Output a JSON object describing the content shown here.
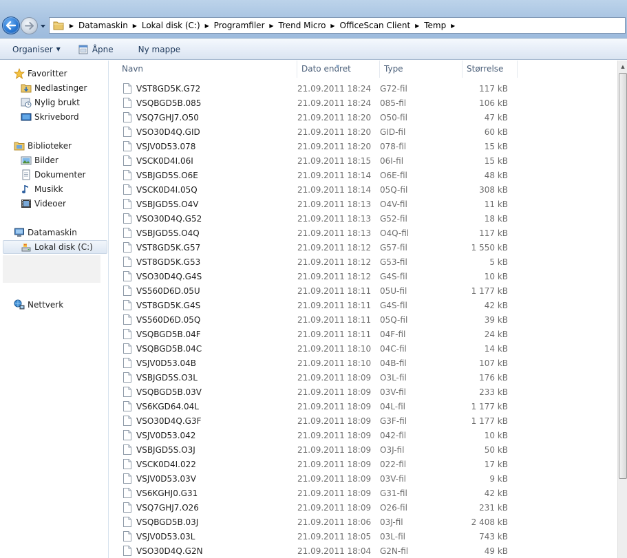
{
  "address": {
    "crumbs": [
      "Datamaskin",
      "Lokal disk (C:)",
      "Programfiler",
      "Trend Micro",
      "OfficeScan Client",
      "Temp"
    ]
  },
  "toolbar": {
    "organize_label": "Organiser",
    "open_label": "Åpne",
    "new_folder_label": "Ny mappe"
  },
  "nav": {
    "favorites": "Favoritter",
    "downloads": "Nedlastinger",
    "recent": "Nylig brukt",
    "desktop": "Skrivebord",
    "libraries": "Biblioteker",
    "pictures": "Bilder",
    "documents": "Dokumenter",
    "music": "Musikk",
    "videos": "Videoer",
    "computer": "Datamaskin",
    "local_disk": "Lokal disk (C:)",
    "network": "Nettverk"
  },
  "columns": {
    "name": "Navn",
    "date": "Dato endret",
    "type": "Type",
    "size": "Størrelse"
  },
  "files": [
    {
      "name": "VST8GD5K.G72",
      "date": "21.09.2011 18:24",
      "type": "G72-fil",
      "size": "117 kB"
    },
    {
      "name": "VSQBGD5B.085",
      "date": "21.09.2011 18:24",
      "type": "085-fil",
      "size": "106 kB"
    },
    {
      "name": "VSQ7GHJ7.O50",
      "date": "21.09.2011 18:20",
      "type": "O50-fil",
      "size": "47 kB"
    },
    {
      "name": "VSO30D4Q.GID",
      "date": "21.09.2011 18:20",
      "type": "GID-fil",
      "size": "60 kB"
    },
    {
      "name": "VSJV0D53.078",
      "date": "21.09.2011 18:20",
      "type": "078-fil",
      "size": "15 kB"
    },
    {
      "name": "VSCK0D4I.06I",
      "date": "21.09.2011 18:15",
      "type": "06I-fil",
      "size": "15 kB"
    },
    {
      "name": "VSBJGD5S.O6E",
      "date": "21.09.2011 18:14",
      "type": "O6E-fil",
      "size": "48 kB"
    },
    {
      "name": "VSCK0D4I.05Q",
      "date": "21.09.2011 18:14",
      "type": "05Q-fil",
      "size": "308 kB"
    },
    {
      "name": "VSBJGD5S.O4V",
      "date": "21.09.2011 18:13",
      "type": "O4V-fil",
      "size": "11 kB"
    },
    {
      "name": "VSO30D4Q.G52",
      "date": "21.09.2011 18:13",
      "type": "G52-fil",
      "size": "18 kB"
    },
    {
      "name": "VSBJGD5S.O4Q",
      "date": "21.09.2011 18:13",
      "type": "O4Q-fil",
      "size": "117 kB"
    },
    {
      "name": "VST8GD5K.G57",
      "date": "21.09.2011 18:12",
      "type": "G57-fil",
      "size": "1 550 kB"
    },
    {
      "name": "VST8GD5K.G53",
      "date": "21.09.2011 18:12",
      "type": "G53-fil",
      "size": "5 kB"
    },
    {
      "name": "VSO30D4Q.G4S",
      "date": "21.09.2011 18:12",
      "type": "G4S-fil",
      "size": "10 kB"
    },
    {
      "name": "VS560D6D.05U",
      "date": "21.09.2011 18:11",
      "type": "05U-fil",
      "size": "1 177 kB"
    },
    {
      "name": "VST8GD5K.G4S",
      "date": "21.09.2011 18:11",
      "type": "G4S-fil",
      "size": "42 kB"
    },
    {
      "name": "VS560D6D.05Q",
      "date": "21.09.2011 18:11",
      "type": "05Q-fil",
      "size": "39 kB"
    },
    {
      "name": "VSQBGD5B.04F",
      "date": "21.09.2011 18:11",
      "type": "04F-fil",
      "size": "24 kB"
    },
    {
      "name": "VSQBGD5B.04C",
      "date": "21.09.2011 18:10",
      "type": "04C-fil",
      "size": "14 kB"
    },
    {
      "name": "VSJV0D53.04B",
      "date": "21.09.2011 18:10",
      "type": "04B-fil",
      "size": "107 kB"
    },
    {
      "name": "VSBJGD5S.O3L",
      "date": "21.09.2011 18:09",
      "type": "O3L-fil",
      "size": "176 kB"
    },
    {
      "name": "VSQBGD5B.03V",
      "date": "21.09.2011 18:09",
      "type": "03V-fil",
      "size": "233 kB"
    },
    {
      "name": "VS6KGD64.04L",
      "date": "21.09.2011 18:09",
      "type": "04L-fil",
      "size": "1 177 kB"
    },
    {
      "name": "VSO30D4Q.G3F",
      "date": "21.09.2011 18:09",
      "type": "G3F-fil",
      "size": "1 177 kB"
    },
    {
      "name": "VSJV0D53.042",
      "date": "21.09.2011 18:09",
      "type": "042-fil",
      "size": "10 kB"
    },
    {
      "name": "VSBJGD5S.O3J",
      "date": "21.09.2011 18:09",
      "type": "O3J-fil",
      "size": "50 kB"
    },
    {
      "name": "VSCK0D4I.022",
      "date": "21.09.2011 18:09",
      "type": "022-fil",
      "size": "17 kB"
    },
    {
      "name": "VSJV0D53.03V",
      "date": "21.09.2011 18:09",
      "type": "03V-fil",
      "size": "9 kB"
    },
    {
      "name": "VS6KGHJ0.G31",
      "date": "21.09.2011 18:09",
      "type": "G31-fil",
      "size": "42 kB"
    },
    {
      "name": "VSQ7GHJ7.O26",
      "date": "21.09.2011 18:09",
      "type": "O26-fil",
      "size": "231 kB"
    },
    {
      "name": "VSQBGD5B.03J",
      "date": "21.09.2011 18:06",
      "type": "03J-fil",
      "size": "2 408 kB"
    },
    {
      "name": "VSJV0D53.03L",
      "date": "21.09.2011 18:05",
      "type": "03L-fil",
      "size": "743 kB"
    },
    {
      "name": "VSO30D4Q.G2N",
      "date": "21.09.2011 18:04",
      "type": "G2N-fil",
      "size": "49 kB"
    }
  ],
  "icons": {
    "back": "back-arrow-icon",
    "forward": "forward-arrow-icon",
    "folder": "folder-icon",
    "file": "file-icon",
    "favorites": "star-icon",
    "computer": "computer-icon",
    "network": "network-icon"
  }
}
